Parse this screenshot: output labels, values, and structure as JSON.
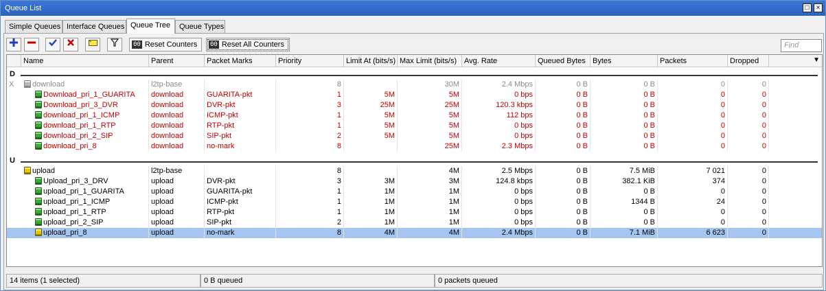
{
  "window": {
    "title": "Queue List"
  },
  "tabs": [
    "Simple Queues",
    "Interface Queues",
    "Queue Tree",
    "Queue Types"
  ],
  "toolbar": {
    "reset_counters": "Reset Counters",
    "reset_all_counters": "Reset All Counters",
    "counter_badge": "00",
    "find_placeholder": "Find"
  },
  "columns": [
    "Name",
    "Parent",
    "Packet Marks",
    "Priority",
    "Limit At (bits/s)",
    "Max Limit (bits/s)",
    "Avg. Rate",
    "Queued Bytes",
    "Bytes",
    "Packets",
    "Dropped"
  ],
  "groups": [
    {
      "label": "D",
      "rows": [
        {
          "name": "download",
          "parent": "l2tp-base",
          "marks": "",
          "priority": "8",
          "limit_at": "",
          "max_limit": "30M",
          "avg_rate": "2.4 Mbps",
          "queued_bytes": "0 B",
          "bytes": "0 B",
          "packets": "0",
          "dropped": "0",
          "style": "dim",
          "icon": "gray",
          "flag": "X"
        },
        {
          "name": "Download_pri_1_GUARITA",
          "parent": "download",
          "marks": "GUARITA-pkt",
          "priority": "1",
          "limit_at": "5M",
          "max_limit": "5M",
          "avg_rate": "0 bps",
          "queued_bytes": "0 B",
          "bytes": "0 B",
          "packets": "0",
          "dropped": "0",
          "style": "red",
          "icon": "green"
        },
        {
          "name": "Download_pri_3_DVR",
          "parent": "download",
          "marks": "DVR-pkt",
          "priority": "3",
          "limit_at": "25M",
          "max_limit": "25M",
          "avg_rate": "120.3 kbps",
          "queued_bytes": "0 B",
          "bytes": "0 B",
          "packets": "0",
          "dropped": "0",
          "style": "red",
          "icon": "green"
        },
        {
          "name": "download_pri_1_ICMP",
          "parent": "download",
          "marks": "ICMP-pkt",
          "priority": "1",
          "limit_at": "5M",
          "max_limit": "5M",
          "avg_rate": "112 bps",
          "queued_bytes": "0 B",
          "bytes": "0 B",
          "packets": "0",
          "dropped": "0",
          "style": "red",
          "icon": "green"
        },
        {
          "name": "download_pri_1_RTP",
          "parent": "download",
          "marks": "RTP-pkt",
          "priority": "1",
          "limit_at": "5M",
          "max_limit": "5M",
          "avg_rate": "0 bps",
          "queued_bytes": "0 B",
          "bytes": "0 B",
          "packets": "0",
          "dropped": "0",
          "style": "red",
          "icon": "green"
        },
        {
          "name": "download_pri_2_SIP",
          "parent": "download",
          "marks": "SIP-pkt",
          "priority": "2",
          "limit_at": "5M",
          "max_limit": "5M",
          "avg_rate": "0 bps",
          "queued_bytes": "0 B",
          "bytes": "0 B",
          "packets": "0",
          "dropped": "0",
          "style": "red",
          "icon": "green"
        },
        {
          "name": "download_pri_8",
          "parent": "download",
          "marks": "no-mark",
          "priority": "8",
          "limit_at": "",
          "max_limit": "25M",
          "avg_rate": "2.3 Mbps",
          "queued_bytes": "0 B",
          "bytes": "0 B",
          "packets": "0",
          "dropped": "0",
          "style": "red",
          "icon": "green"
        }
      ]
    },
    {
      "label": "U",
      "rows": [
        {
          "name": "upload",
          "parent": "l2tp-base",
          "marks": "",
          "priority": "8",
          "limit_at": "",
          "max_limit": "4M",
          "avg_rate": "2.5 Mbps",
          "queued_bytes": "0 B",
          "bytes": "7.5 MiB",
          "packets": "7 021",
          "dropped": "0",
          "style": "normal",
          "icon": "yellow"
        },
        {
          "name": "Upload_pri_3_DRV",
          "parent": "upload",
          "marks": "DVR-pkt",
          "priority": "3",
          "limit_at": "3M",
          "max_limit": "3M",
          "avg_rate": "124.8 kbps",
          "queued_bytes": "0 B",
          "bytes": "382.1 KiB",
          "packets": "374",
          "dropped": "0",
          "style": "normal",
          "icon": "green"
        },
        {
          "name": "upload_pri_1_GUARITA",
          "parent": "upload",
          "marks": "GUARITA-pkt",
          "priority": "1",
          "limit_at": "1M",
          "max_limit": "1M",
          "avg_rate": "0 bps",
          "queued_bytes": "0 B",
          "bytes": "0 B",
          "packets": "0",
          "dropped": "0",
          "style": "normal",
          "icon": "green"
        },
        {
          "name": "upload_pri_1_ICMP",
          "parent": "upload",
          "marks": "ICMP-pkt",
          "priority": "1",
          "limit_at": "1M",
          "max_limit": "1M",
          "avg_rate": "0 bps",
          "queued_bytes": "0 B",
          "bytes": "1344 B",
          "packets": "24",
          "dropped": "0",
          "style": "normal",
          "icon": "green"
        },
        {
          "name": "upload_pri_1_RTP",
          "parent": "upload",
          "marks": "RTP-pkt",
          "priority": "1",
          "limit_at": "1M",
          "max_limit": "1M",
          "avg_rate": "0 bps",
          "queued_bytes": "0 B",
          "bytes": "0 B",
          "packets": "0",
          "dropped": "0",
          "style": "normal",
          "icon": "green"
        },
        {
          "name": "upload_pri_2_SIP",
          "parent": "upload",
          "marks": "SIP-pkt",
          "priority": "2",
          "limit_at": "1M",
          "max_limit": "1M",
          "avg_rate": "0 bps",
          "queued_bytes": "0 B",
          "bytes": "0 B",
          "packets": "0",
          "dropped": "0",
          "style": "normal",
          "icon": "green"
        },
        {
          "name": "upload_pri_8",
          "parent": "upload",
          "marks": "no-mark",
          "priority": "8",
          "limit_at": "4M",
          "max_limit": "4M",
          "avg_rate": "2.4 Mbps",
          "queued_bytes": "0 B",
          "bytes": "7.1 MiB",
          "packets": "6 623",
          "dropped": "0",
          "style": "selected",
          "icon": "yellow"
        }
      ]
    }
  ],
  "status": {
    "items": "14 items (1 selected)",
    "queued": "0 B queued",
    "packets_queued": "0 packets queued"
  }
}
